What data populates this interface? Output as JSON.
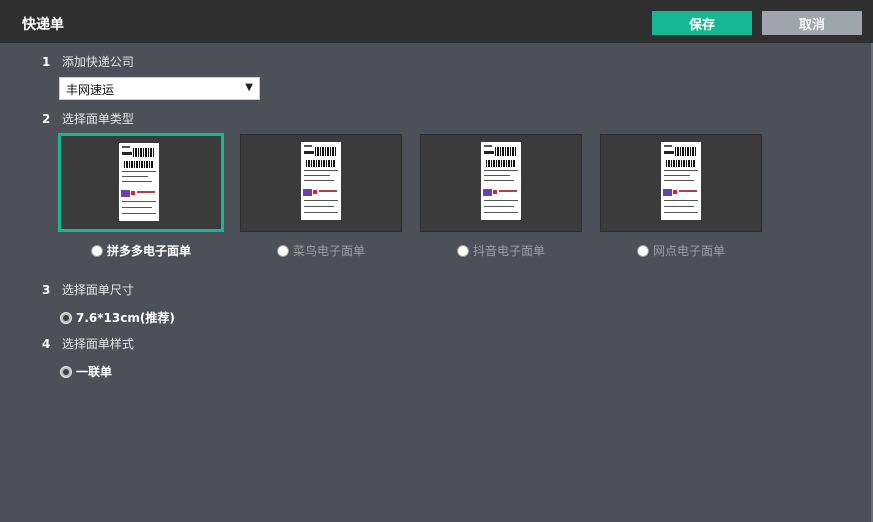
{
  "dialog": {
    "title": "快递单",
    "save_label": "保存",
    "cancel_label": "取消"
  },
  "steps": [
    {
      "num": "1",
      "label": "添加快递公司"
    },
    {
      "num": "2",
      "label": "选择面单类型"
    },
    {
      "num": "3",
      "label": "选择面单尺寸"
    },
    {
      "num": "4",
      "label": "选择面单样式"
    }
  ],
  "company_select": {
    "value": "丰网速运",
    "arrow": "▼"
  },
  "waybill_types": [
    {
      "label": "拼多多电子面单",
      "selected": true
    },
    {
      "label": "菜鸟电子面单",
      "selected": false
    },
    {
      "label": "抖音电子面单",
      "selected": false
    },
    {
      "label": "网点电子面单",
      "selected": false
    }
  ],
  "size_option": {
    "label": "7.6*13cm(推荐)"
  },
  "style_option": {
    "label": "一联单"
  },
  "colors": {
    "accent": "#16b894",
    "header_bg": "#2f2f2f",
    "body_bg": "#4e5059",
    "cancel_bg": "#9fa5ab"
  }
}
